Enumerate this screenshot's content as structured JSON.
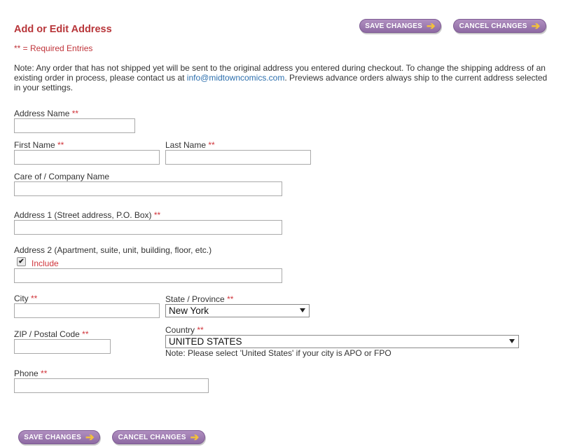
{
  "header": {
    "title": "Add or Edit Address",
    "required_marker": "**",
    "required_legend": " = Required Entries",
    "note_before_email": "Note: Any order that has not shipped yet will be sent to the original address you entered during checkout. To change the shipping address of an existing order in process, please contact us at ",
    "email": "info@midtowncomics.com",
    "note_after_email": ". Previews advance orders always ship to the current address selected in your settings."
  },
  "buttons": {
    "save_label": "SAVE CHANGES",
    "cancel_label": "CANCEL CHANGES",
    "arrow": "➔"
  },
  "form": {
    "address_name": {
      "label": "Address Name",
      "required": "**",
      "value": ""
    },
    "first_name": {
      "label": "First Name",
      "required": "**",
      "value": ""
    },
    "last_name": {
      "label": "Last Name",
      "required": "**",
      "value": ""
    },
    "care_of": {
      "label": "Care of / Company Name",
      "value": ""
    },
    "address1": {
      "label": "Address 1 (Street address, P.O. Box)",
      "required": "**",
      "value": ""
    },
    "address2": {
      "label": "Address 2 (Apartment, suite, unit, building, floor, etc.)",
      "include_label": "Include",
      "include_checked": true,
      "value": ""
    },
    "city": {
      "label": "City",
      "required": "**",
      "value": ""
    },
    "state": {
      "label": "State / Province",
      "required": "**",
      "selected": "New York"
    },
    "zip": {
      "label": "ZIP / Postal Code",
      "required": "**",
      "value": ""
    },
    "country": {
      "label": "Country",
      "required": "**",
      "selected": "UNITED STATES",
      "note": "Note: Please select 'United States' if your city is APO or FPO"
    },
    "phone": {
      "label": "Phone",
      "required": "**",
      "value": ""
    }
  },
  "colors": {
    "accent_red": "#b8363a",
    "link_blue": "#2c6fad",
    "button_purple": "#9b78b0",
    "arrow_gold": "#f3c13a"
  }
}
